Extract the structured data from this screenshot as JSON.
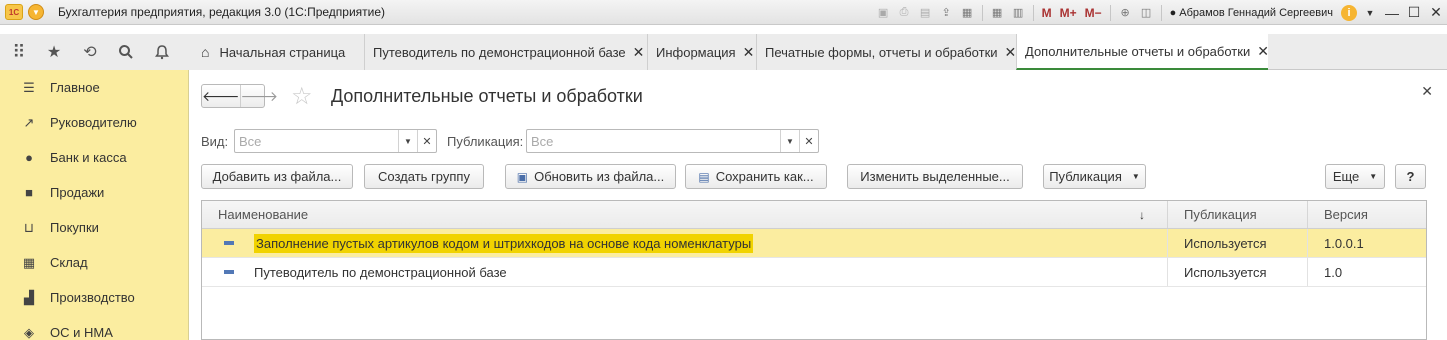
{
  "window": {
    "title": "Бухгалтерия предприятия, редакция 3.0  (1С:Предприятие)",
    "logo": "1С",
    "user": "Абрамов Геннадий Сергеевич",
    "toolbar_m": [
      "M",
      "M+",
      "M−"
    ]
  },
  "nav_tools": [
    {
      "name": "apps-grid-icon",
      "glyph": "⋮⋮⋮"
    },
    {
      "name": "favorites-star-icon",
      "glyph": "★"
    },
    {
      "name": "history-icon",
      "glyph": "⟲"
    },
    {
      "name": "search-icon",
      "glyph": "⚲"
    },
    {
      "name": "notifications-bell-icon",
      "glyph": "🔔"
    }
  ],
  "tabs": [
    {
      "label": "Начальная страница"
    },
    {
      "label": "Путеводитель по демонстрационной базе"
    },
    {
      "label": "Информация"
    },
    {
      "label": "Печатные формы, отчеты и обработки"
    },
    {
      "label": "Дополнительные отчеты и обработки"
    }
  ],
  "sidebar": {
    "items": [
      {
        "label": "Главное",
        "icon": "menu-icon"
      },
      {
        "label": "Руководителю",
        "icon": "trend-icon"
      },
      {
        "label": "Банк и касса",
        "icon": "coin-icon"
      },
      {
        "label": "Продажи",
        "icon": "shopping-bag-icon"
      },
      {
        "label": "Покупки",
        "icon": "cart-icon"
      },
      {
        "label": "Склад",
        "icon": "warehouse-icon"
      },
      {
        "label": "Производство",
        "icon": "factory-icon"
      },
      {
        "label": "ОС и НМА",
        "icon": "assets-icon"
      }
    ]
  },
  "page": {
    "title": "Дополнительные отчеты и обработки",
    "filters": {
      "view_label": "Вид:",
      "view_value": "Все",
      "publication_label": "Публикация:",
      "publication_value": "Все"
    },
    "buttons": {
      "add_from_file": "Добавить из файла...",
      "create_group": "Создать группу",
      "update_from_file": "Обновить из файла...",
      "save_as": "Сохранить как...",
      "change_selected": "Изменить выделенные...",
      "publication": "Публикация",
      "more": "Еще",
      "help": "?"
    },
    "table": {
      "columns": [
        "Наименование",
        "Публикация",
        "Версия"
      ],
      "rows": [
        {
          "name": "Заполнение пустых артикулов кодом и штрихкодов на основе кода номенклатуры",
          "publication": "Используется",
          "version": "1.0.0.1"
        },
        {
          "name": "Путеводитель по демонстрационной базе",
          "publication": "Используется",
          "version": "1.0"
        }
      ]
    }
  },
  "colors": {
    "sidebar_bg": "#fbeda0",
    "selected_row": "#fbeda0",
    "highlight": "#f1d300",
    "active_tab_underline": "#3a8a3a"
  }
}
